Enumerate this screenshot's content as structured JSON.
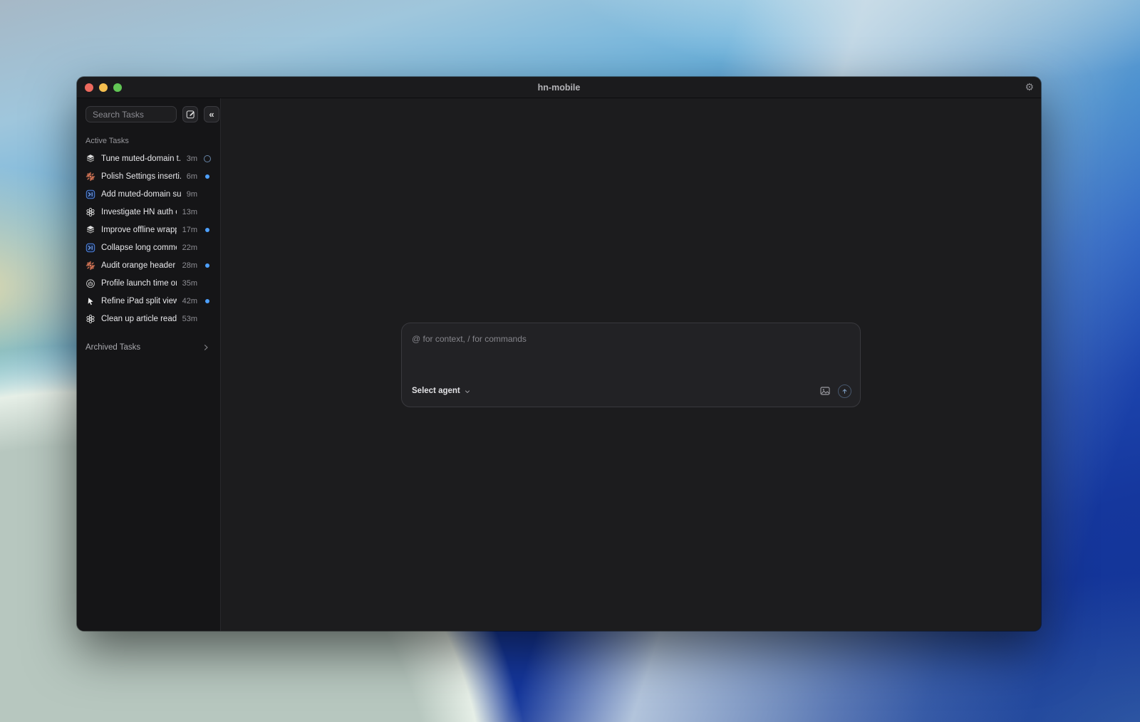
{
  "window": {
    "title": "hn-mobile"
  },
  "sidebar": {
    "search_placeholder": "Search Tasks",
    "active_header": "Active Tasks",
    "archived_label": "Archived Tasks",
    "tasks": [
      {
        "icon": "cube",
        "label": "Tune muted-domain t...",
        "time": "3m",
        "indicator": "spinner"
      },
      {
        "icon": "claude",
        "label": "Polish Settings inserti...",
        "time": "6m",
        "indicator": "dot"
      },
      {
        "icon": "codex",
        "label": "Add muted-domain su...",
        "time": "9m",
        "indicator": "none"
      },
      {
        "icon": "openai",
        "label": "Investigate HN auth c...",
        "time": "13m",
        "indicator": "none"
      },
      {
        "icon": "cube",
        "label": "Improve offline wrapp...",
        "time": "17m",
        "indicator": "dot"
      },
      {
        "icon": "codex",
        "label": "Collapse long comme...",
        "time": "22m",
        "indicator": "none"
      },
      {
        "icon": "claude",
        "label": "Audit orange header c...",
        "time": "28m",
        "indicator": "dot"
      },
      {
        "icon": "bot",
        "label": "Profile launch time on ...",
        "time": "35m",
        "indicator": "none"
      },
      {
        "icon": "cursor",
        "label": "Refine iPad split view l...",
        "time": "42m",
        "indicator": "dot"
      },
      {
        "icon": "openai",
        "label": "Clean up article reader...",
        "time": "53m",
        "indicator": "none"
      }
    ]
  },
  "composer": {
    "placeholder": "@ for context, / for commands",
    "agent_selector_label": "Select agent"
  },
  "icons": {
    "titlebar_right": "gear-icon",
    "sidebar_top": [
      "compose-icon",
      "collapse-sidebar-icon"
    ],
    "composer_actions": [
      "image-attach-icon",
      "send-arrow-icon"
    ]
  },
  "colors": {
    "unread_dot_blue": "#4da0ff",
    "claude_orange": "#d97757",
    "codex_blue": "#6b9bf0",
    "spinner_ring": "#6886a8",
    "traffic_red": "#ed6a5e",
    "traffic_yellow": "#f5bf4f",
    "traffic_green": "#61c554",
    "window_bg": "#1c1c1e",
    "sidebar_bg": "#151517"
  }
}
